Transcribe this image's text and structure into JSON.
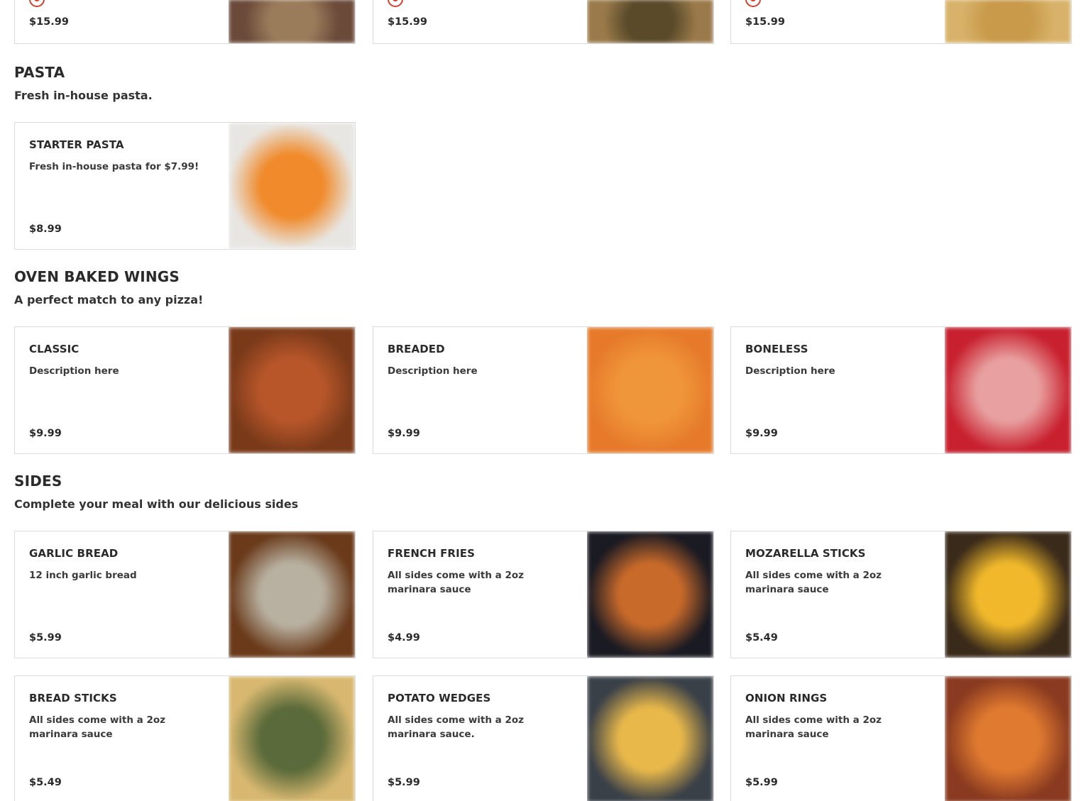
{
  "top_row": [
    {
      "price": "$15.99",
      "icon": "spicy-icon",
      "photo_colors": [
        "#6b4a3a",
        "#9a7b5a",
        "#3d6a3a"
      ]
    },
    {
      "price": "$15.99",
      "icon": "spicy-icon",
      "photo_colors": [
        "#9a7a4a",
        "#5a4a2a",
        "#2a2a2a"
      ]
    },
    {
      "price": "$15.99",
      "icon": "spicy-icon",
      "photo_colors": [
        "#d8b26a",
        "#c89a4a",
        "#8a8a7a"
      ]
    }
  ],
  "sections": [
    {
      "title": "PASTA",
      "subtitle": "Fresh in-house pasta.",
      "items": [
        {
          "name": "STARTER PASTA",
          "description": "Fresh in-house pasta for $7.99!",
          "price": "$8.99",
          "photo_colors": [
            "#e8e6e2",
            "#f08a2a",
            "#b8b6b0"
          ]
        }
      ]
    },
    {
      "title": "OVEN BAKED WINGS",
      "subtitle": "A perfect match to any pizza!",
      "items": [
        {
          "name": "CLASSIC",
          "description": "Description here",
          "price": "$9.99",
          "photo_colors": [
            "#7a3a1a",
            "#b8562a",
            "#2a1a10"
          ]
        },
        {
          "name": "BREADED",
          "description": "Description here",
          "price": "$9.99",
          "photo_colors": [
            "#e67a2a",
            "#f0963a",
            "#3a2a1a"
          ]
        },
        {
          "name": "BONELESS",
          "description": "Description here",
          "price": "$9.99",
          "photo_colors": [
            "#c8202e",
            "#e8a0a0",
            "#c8202e"
          ]
        }
      ]
    },
    {
      "title": "SIDES",
      "subtitle": "Complete your meal with our delicious sides",
      "items": [
        {
          "name": "GARLIC BREAD",
          "description": "12 inch garlic bread",
          "price": "$5.99",
          "photo_colors": [
            "#6a3a1a",
            "#b8b0a0",
            "#9a8a6a"
          ]
        },
        {
          "name": "FRENCH FRIES",
          "description": "All sides come with a 2oz marinara sauce",
          "price": "$4.99",
          "photo_colors": [
            "#1a1a22",
            "#c86a2a",
            "#2a2a30"
          ]
        },
        {
          "name": "MOZARELLA STICKS",
          "description": "All sides come with a 2oz marinara sauce",
          "price": "$5.49",
          "photo_colors": [
            "#3a2a1a",
            "#f0b82a",
            "#8a6a4a"
          ]
        },
        {
          "name": "BREAD STICKS",
          "description": "All sides come with a 2oz marinara sauce",
          "price": "$5.49",
          "photo_colors": [
            "#d8b870",
            "#5a6a3a",
            "#c8a860"
          ]
        },
        {
          "name": "POTATO WEDGES",
          "description": "All sides come with a 2oz marinara sauce.",
          "price": "$5.99",
          "photo_colors": [
            "#3a4048",
            "#e8b84a",
            "#3a4048"
          ]
        },
        {
          "name": "ONION RINGS",
          "description": "All sides come with a 2oz marinara sauce",
          "price": "$5.99",
          "photo_colors": [
            "#8a3a20",
            "#e07a30",
            "#c05a2a"
          ]
        }
      ]
    }
  ]
}
